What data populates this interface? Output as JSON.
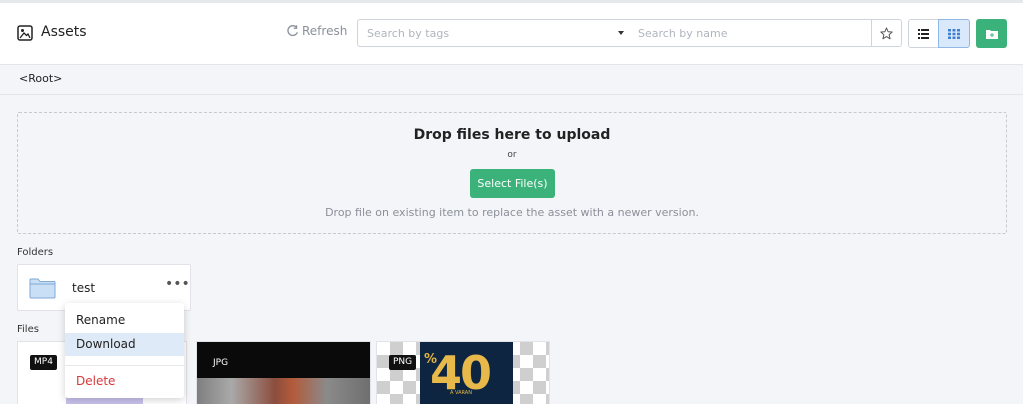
{
  "header": {
    "title": "Assets",
    "refresh_label": "Refresh",
    "tags_search_placeholder": "Search by tags",
    "name_search_placeholder": "Search by name"
  },
  "breadcrumb": "<Root>",
  "dropzone": {
    "title": "Drop files here to upload",
    "or": "or",
    "select_label": "Select File(s)",
    "hint": "Drop file on existing item to replace the asset with a newer version."
  },
  "folders": {
    "label": "Folders",
    "items": [
      {
        "name": "test",
        "more": "•••"
      }
    ]
  },
  "files": {
    "label": "Files",
    "items": [
      {
        "badge": "MP4"
      },
      {
        "badge": "JPG"
      },
      {
        "badge": "PNG",
        "thumb_percent": "%",
        "thumb_number": "40",
        "thumb_sub": "A VARAN"
      }
    ]
  },
  "context_menu": {
    "items": [
      {
        "label": "Rename"
      },
      {
        "label": "Download"
      },
      {
        "label": "Delete"
      }
    ]
  },
  "colors": {
    "accent_green": "#3cb27b",
    "active_blue": "#d9e8fa",
    "danger_red": "#d9373b"
  },
  "icons": [
    "assets-icon",
    "refresh-icon",
    "star-icon",
    "list-view-icon",
    "grid-view-icon",
    "new-folder-icon",
    "folder-icon",
    "more-icon"
  ]
}
